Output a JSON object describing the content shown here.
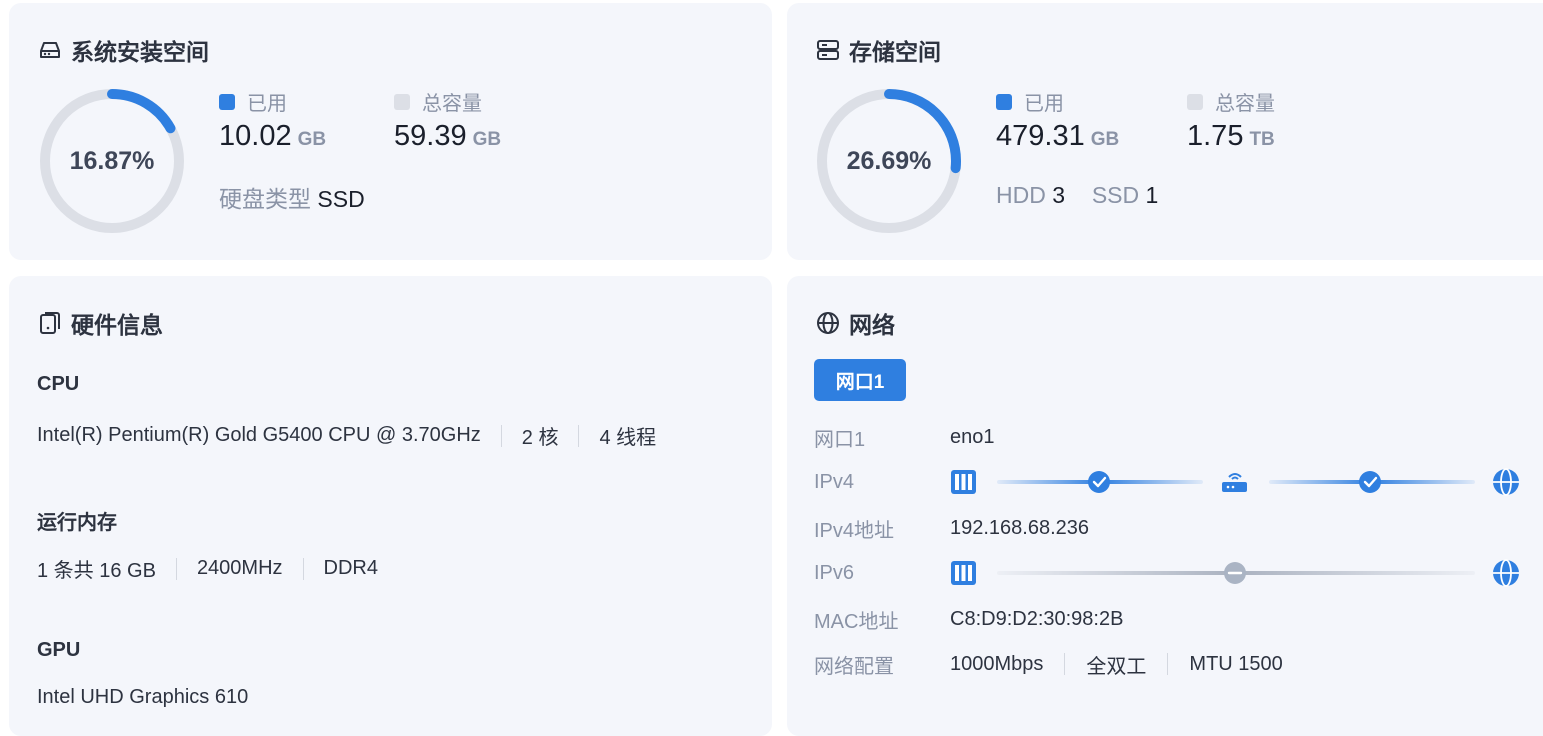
{
  "system_space": {
    "title": "系统安装空间",
    "percent": "16.87%",
    "percent_value": 16.87,
    "used_label": "已用",
    "used_value": "10.02",
    "used_unit": "GB",
    "total_label": "总容量",
    "total_value": "59.39",
    "total_unit": "GB",
    "disk_type_label": "硬盘类型",
    "disk_type_value": "SSD"
  },
  "storage_space": {
    "title": "存储空间",
    "percent": "26.69%",
    "percent_value": 26.69,
    "used_label": "已用",
    "used_value": "479.31",
    "used_unit": "GB",
    "total_label": "总容量",
    "total_value": "1.75",
    "total_unit": "TB",
    "hdd_label": "HDD",
    "hdd_count": "3",
    "ssd_label": "SSD",
    "ssd_count": "1"
  },
  "hardware": {
    "title": "硬件信息",
    "cpu_label": "CPU",
    "cpu_model": "Intel(R) Pentium(R) Gold G5400 CPU @ 3.70GHz",
    "cpu_cores": "2 核",
    "cpu_threads": "4 线程",
    "memory_label": "运行内存",
    "memory_count": "1 条共 16 GB",
    "memory_speed": "2400MHz",
    "memory_type": "DDR4",
    "gpu_label": "GPU",
    "gpu_model": "Intel UHD Graphics 610"
  },
  "network": {
    "title": "网络",
    "tab_label": "网口1",
    "rows": {
      "port_key": "网口1",
      "port_value": "eno1",
      "ipv4_key": "IPv4",
      "ipv4_addr_key": "IPv4地址",
      "ipv4_addr_value": "192.168.68.236",
      "ipv6_key": "IPv6",
      "mac_key": "MAC地址",
      "mac_value": "C8:D9:D2:30:98:2B",
      "config_key": "网络配置",
      "config_speed": "1000Mbps",
      "config_duplex": "全双工",
      "config_mtu": "MTU 1500"
    },
    "ipv4_status": [
      "ok",
      "ok"
    ],
    "ipv6_status": [
      "disconnected"
    ]
  },
  "colors": {
    "accent": "#2f7fe0",
    "ring_track": "#dcdfe6",
    "card_bg": "#f4f6fb",
    "muted": "#8a93a6",
    "total_square": "#dcdfe6"
  },
  "icons": {
    "system_space": "drive-icon",
    "storage_space": "server-icon",
    "hardware": "device-icon",
    "network": "globe-icon"
  }
}
